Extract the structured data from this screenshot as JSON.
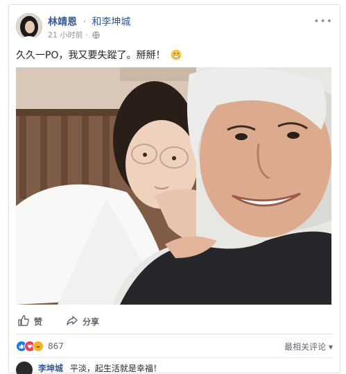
{
  "post": {
    "author": "林靖恩",
    "separator": "·",
    "group": "和李坤城",
    "time": "21 小时前",
    "meta_sep": "·",
    "text": "久久一PO，我又要失蹤了。掰掰！",
    "more_icon": "more-icon"
  },
  "actions": {
    "like_label": "赞",
    "share_label": "分享"
  },
  "reactions": {
    "count": "867",
    "icons": [
      "like-icon",
      "love-icon",
      "haha-icon"
    ]
  },
  "sort": {
    "label": "最相关评论",
    "arrow": "▾"
  },
  "comment": {
    "author": "李坤城",
    "text": "平淡，起生活就是幸福！"
  },
  "colors": {
    "link": "#365899",
    "muted": "#90949c",
    "like": "#1877f2",
    "love": "#f33e58",
    "haha": "#f7b125"
  }
}
